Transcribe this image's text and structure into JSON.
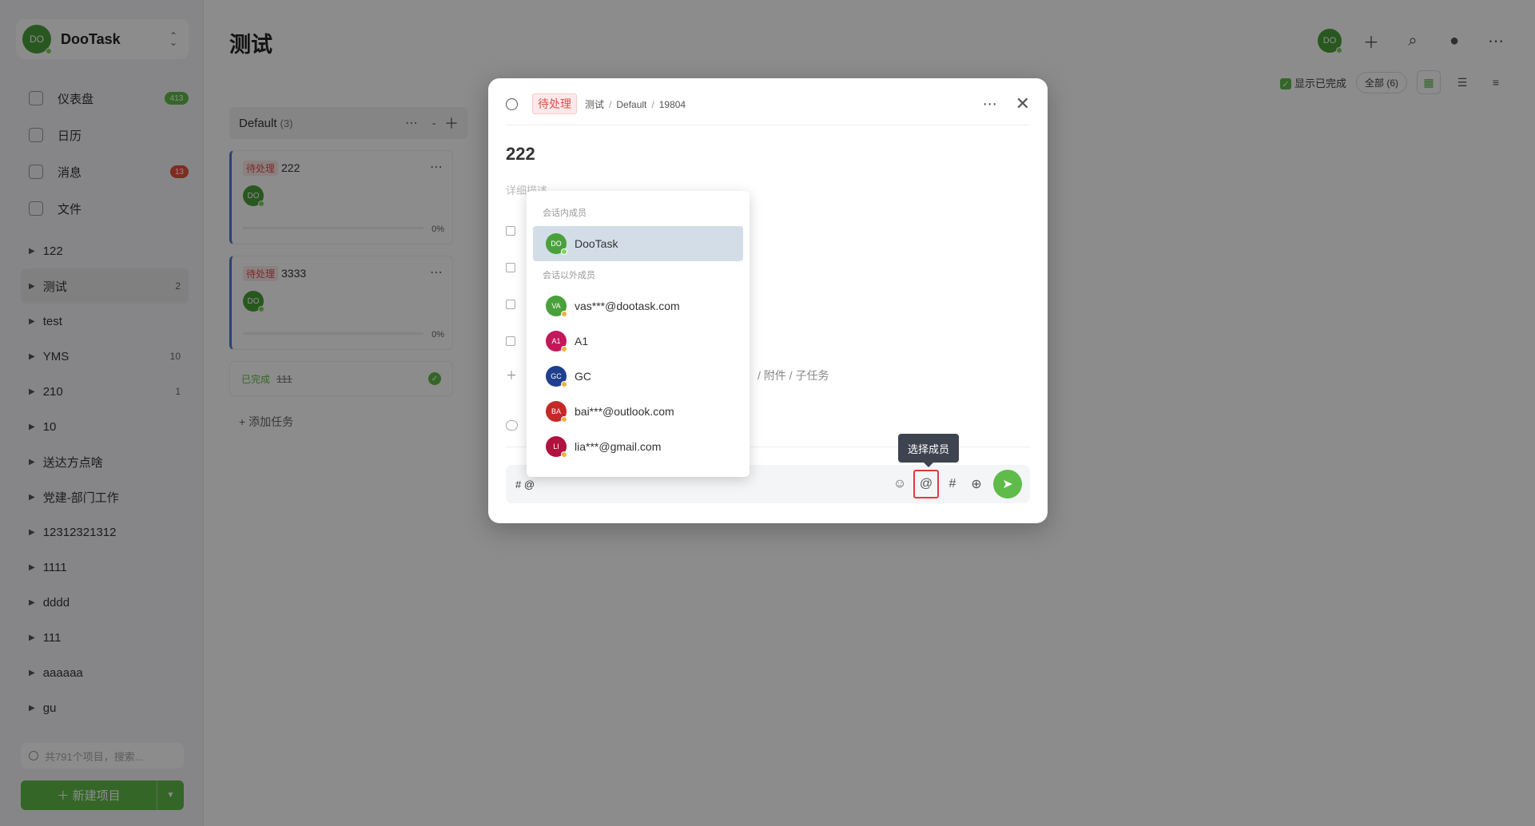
{
  "sidebar": {
    "team": {
      "avatar": "DO",
      "name": "DooTask",
      "switch_icon": "chevron-updown-icon"
    },
    "menu": [
      {
        "label": "仪表盘",
        "badge": "413",
        "icon": "dashboard-icon"
      },
      {
        "label": "日历",
        "badge": "",
        "icon": "calendar-icon"
      },
      {
        "label": "消息",
        "badge": "13",
        "icon": "message-icon"
      },
      {
        "label": "文件",
        "badge": "",
        "icon": "file-icon"
      }
    ],
    "projects": [
      {
        "label": "122",
        "count": ""
      },
      {
        "label": "测试",
        "count": "2"
      },
      {
        "label": "test",
        "count": ""
      },
      {
        "label": "YMS",
        "count": "10"
      },
      {
        "label": "210",
        "count": "1"
      },
      {
        "label": "10",
        "count": ""
      },
      {
        "label": "送达方点啥",
        "count": ""
      },
      {
        "label": "党建-部门工作",
        "count": ""
      },
      {
        "label": "12312321312",
        "count": ""
      },
      {
        "label": "1111",
        "count": ""
      },
      {
        "label": "dddd",
        "count": ""
      },
      {
        "label": "111",
        "count": ""
      },
      {
        "label": "aaaaaa",
        "count": ""
      },
      {
        "label": "gu",
        "count": ""
      }
    ],
    "search_placeholder": "共791个项目，搜索...",
    "new_project": "＋ 新建项目"
  },
  "main": {
    "title": "测试",
    "user_avatar": "DO",
    "show_completed": "显示已完成",
    "filter_all": "全部 (6)",
    "column": {
      "name": "Default",
      "count": "(3)"
    },
    "cards": [
      {
        "tag": "待处理",
        "title": "222",
        "avatar": "DO",
        "percent": "0%"
      },
      {
        "tag": "待处理",
        "title": "3333",
        "avatar": "DO",
        "percent": "0%"
      }
    ],
    "done": {
      "tag": "已完成",
      "title": "111"
    },
    "add_task": "+ 添加任务"
  },
  "modal": {
    "status": "待处理",
    "breadcrumb": [
      "测试",
      "Default",
      "19804"
    ],
    "title": "222",
    "desc_placeholder": "详细描述",
    "add_more_tail": "/ 附件 / 子任务",
    "input_value": "# @",
    "tooltip": "选择成员",
    "colors": {
      "accent": "#5fbb4a",
      "highlight": "#e23b3b",
      "status_red": "#e04f4f"
    }
  },
  "mention": {
    "group_in": "会话内成员",
    "group_out": "会话以外成员",
    "members_in": [
      {
        "abbr": "DO",
        "name": "DooTask",
        "color": "#4aa13a",
        "status": "online"
      }
    ],
    "members_out": [
      {
        "abbr": "VA",
        "name": "vas***@dootask.com",
        "color": "#4aa13a",
        "status": "away"
      },
      {
        "abbr": "A1",
        "name": "A1",
        "color": "#c2185b",
        "status": "away"
      },
      {
        "abbr": "GC",
        "name": "GC",
        "color": "#1f3f8f",
        "status": "away"
      },
      {
        "abbr": "BA",
        "name": "bai***@outlook.com",
        "color": "#c62828",
        "status": "away"
      },
      {
        "abbr": "LI",
        "name": "lia***@gmail.com",
        "color": "#b0133d",
        "status": "away"
      }
    ]
  }
}
